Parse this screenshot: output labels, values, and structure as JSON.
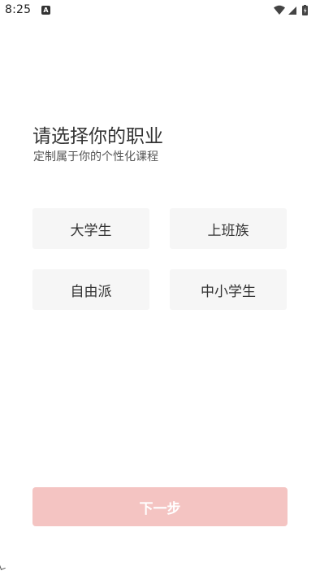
{
  "status_bar": {
    "time": "8:25",
    "app_icon": "A",
    "icons": [
      "wifi-icon",
      "signal-icon",
      "battery-charging-icon"
    ]
  },
  "header": {
    "title": "请选择你的职业",
    "subtitle": "定制属于你的个性化课程"
  },
  "options": [
    {
      "label": "大学生"
    },
    {
      "label": "上班族"
    },
    {
      "label": "自由派"
    },
    {
      "label": "中小学生"
    }
  ],
  "next_button": {
    "label": "下一步",
    "color": "#f4c4c2"
  }
}
